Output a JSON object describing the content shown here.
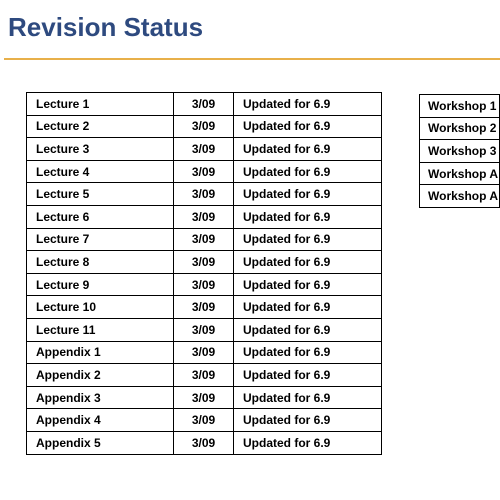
{
  "title": "Revision Status",
  "colors": {
    "title": "#2E4A7F",
    "rule": "#E8B04A"
  },
  "main_table": [
    [
      "Lecture 1",
      "3/09",
      "Updated for 6.9"
    ],
    [
      "Lecture 2",
      "3/09",
      "Updated for 6.9"
    ],
    [
      "Lecture 3",
      "3/09",
      "Updated for 6.9"
    ],
    [
      "Lecture 4",
      "3/09",
      "Updated for 6.9"
    ],
    [
      "Lecture 5",
      "3/09",
      "Updated for 6.9"
    ],
    [
      "Lecture 6",
      "3/09",
      "Updated for 6.9"
    ],
    [
      "Lecture 7",
      "3/09",
      "Updated for 6.9"
    ],
    [
      "Lecture 8",
      "3/09",
      "Updated for 6.9"
    ],
    [
      "Lecture 9",
      "3/09",
      "Updated for 6.9"
    ],
    [
      "Lecture 10",
      "3/09",
      "Updated for 6.9"
    ],
    [
      "Lecture 11",
      "3/09",
      "Updated for 6.9"
    ],
    [
      "Appendix 1",
      "3/09",
      "Updated for 6.9"
    ],
    [
      "Appendix 2",
      "3/09",
      "Updated for 6.9"
    ],
    [
      "Appendix 3",
      "3/09",
      "Updated for 6.9"
    ],
    [
      "Appendix 4",
      "3/09",
      "Updated for 6.9"
    ],
    [
      "Appendix 5",
      "3/09",
      "Updated for 6.9"
    ]
  ],
  "side_table": [
    "Workshop 1",
    "Workshop 2",
    "Workshop 3",
    "Workshop A",
    "Workshop A"
  ]
}
